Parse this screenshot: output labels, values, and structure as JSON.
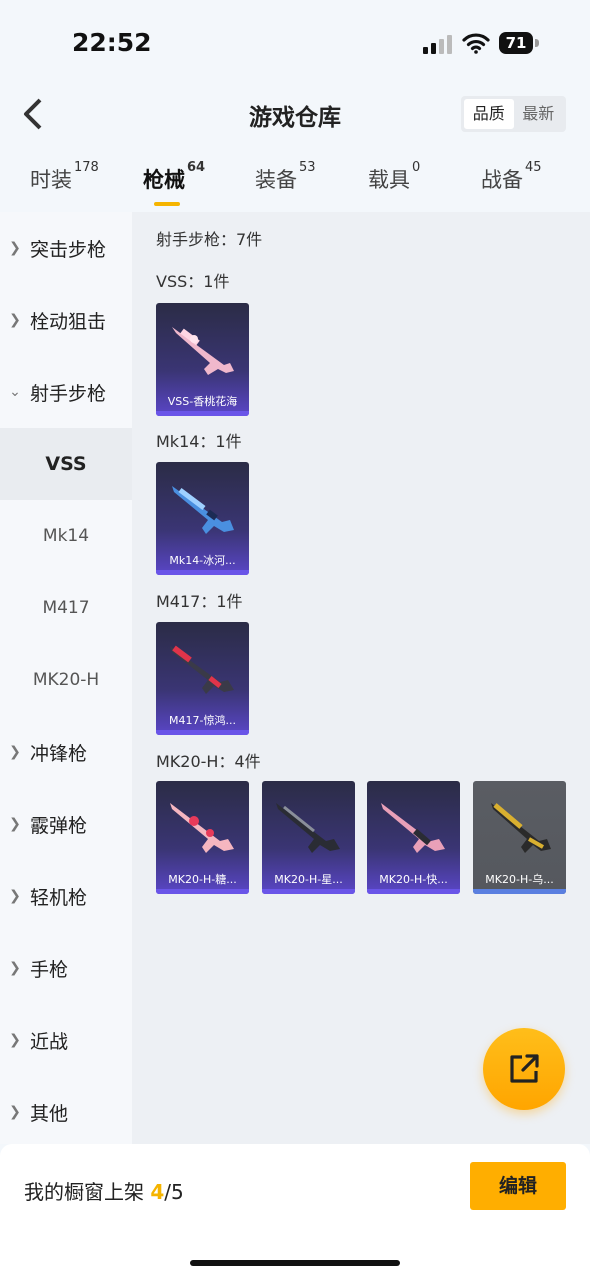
{
  "status": {
    "time": "22:52",
    "battery": "71"
  },
  "nav": {
    "title": "游戏仓库",
    "sort_options": [
      "品质",
      "最新"
    ]
  },
  "tabs": [
    {
      "label": "时装",
      "count": "178"
    },
    {
      "label": "枪械",
      "count": "64"
    },
    {
      "label": "装备",
      "count": "53"
    },
    {
      "label": "载具",
      "count": "0"
    },
    {
      "label": "战备",
      "count": "45"
    }
  ],
  "sidebar": [
    {
      "label": "突击步枪"
    },
    {
      "label": "栓动狙击"
    },
    {
      "label": "射手步枪"
    },
    {
      "label": "VSS"
    },
    {
      "label": "Mk14"
    },
    {
      "label": "M417"
    },
    {
      "label": "MK20-H"
    },
    {
      "label": "冲锋枪"
    },
    {
      "label": "霰弹枪"
    },
    {
      "label": "轻机枪"
    },
    {
      "label": "手枪"
    },
    {
      "label": "近战"
    },
    {
      "label": "其他"
    }
  ],
  "content": {
    "category_header": "射手步枪：7件",
    "groups": [
      {
        "header": "VSS：1件",
        "items": [
          "VSS-香桃花海"
        ]
      },
      {
        "header": "Mk14：1件",
        "items": [
          "Mk14-冰河..."
        ]
      },
      {
        "header": "M417：1件",
        "items": [
          "M417-惊鸿..."
        ]
      },
      {
        "header": "MK20-H：4件",
        "items": [
          "MK20-H-糖...",
          "MK20-H-星...",
          "MK20-H-快...",
          "MK20-H-乌..."
        ]
      }
    ]
  },
  "bottom": {
    "showcase_label": "我的橱窗上架",
    "showcase_current": "4",
    "showcase_total": "/5",
    "edit_label": "编辑"
  },
  "colors": {
    "accent": "#f5b400",
    "button": "#ffae00",
    "card_purple": "#5a46c8"
  }
}
